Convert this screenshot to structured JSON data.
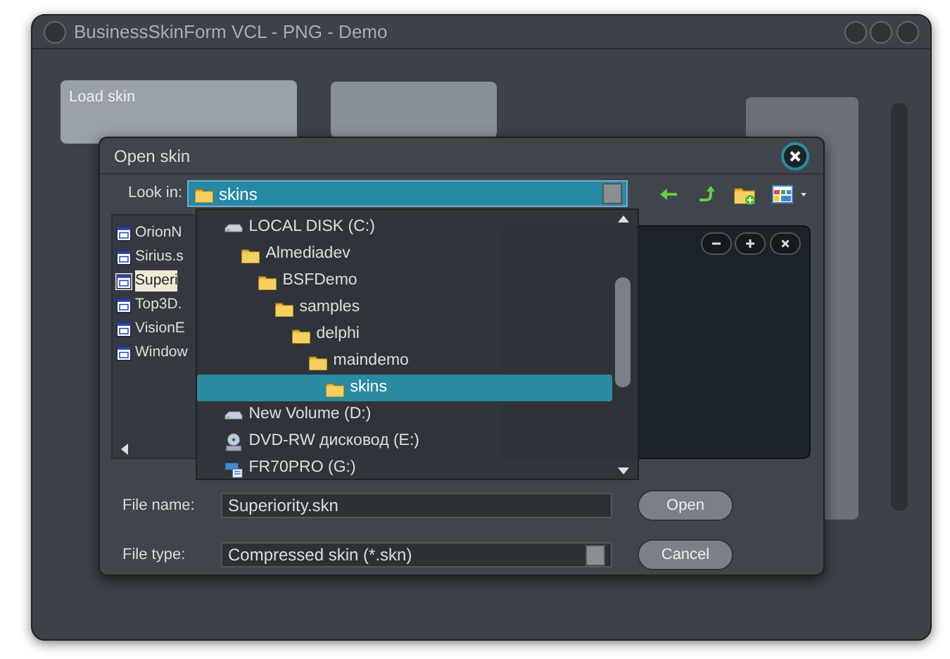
{
  "window": {
    "title": "BusinessSkinForm VCL - PNG - Demo"
  },
  "background": {
    "tile_label": "Load skin"
  },
  "dialog": {
    "title": "Open skin",
    "look_in": {
      "label": "Look in:",
      "value": "skins"
    },
    "files": [
      {
        "name": "OrionN",
        "selected": false
      },
      {
        "name": "Sirius.s",
        "selected": false
      },
      {
        "name": "Superi",
        "selected": true
      },
      {
        "name": "Top3D.",
        "selected": false
      },
      {
        "name": "VisionE",
        "selected": false
      },
      {
        "name": "Window",
        "selected": false
      }
    ],
    "dropdown": [
      {
        "label": "LOCAL DISK (C:)",
        "kind": "drive",
        "selected": false,
        "children": [
          {
            "label": "Almediadev",
            "kind": "folder",
            "selected": false,
            "children": [
              {
                "label": "BSFDemo",
                "kind": "folder",
                "selected": false,
                "children": [
                  {
                    "label": "samples",
                    "kind": "folder",
                    "selected": false,
                    "children": [
                      {
                        "label": "delphi",
                        "kind": "folder",
                        "selected": false,
                        "children": [
                          {
                            "label": "maindemo",
                            "kind": "folder",
                            "selected": false,
                            "children": [
                              {
                                "label": "skins",
                                "kind": "folder",
                                "selected": true
                              }
                            ]
                          }
                        ]
                      }
                    ]
                  }
                ]
              }
            ]
          }
        ]
      },
      {
        "label": "New Volume (D:)",
        "kind": "drive",
        "selected": false
      },
      {
        "label": "DVD-RW дисковод (E:)",
        "kind": "cdrom",
        "selected": false
      },
      {
        "label": "FR70PRO (G:)",
        "kind": "network",
        "selected": false
      }
    ],
    "file_name": {
      "label": "File name:",
      "value": "Superiority.skn"
    },
    "file_type": {
      "label": "File type:",
      "value": "Compressed skin (*.skn)"
    },
    "buttons": [
      {
        "label": "Open"
      },
      {
        "label": "Cancel"
      }
    ]
  }
}
